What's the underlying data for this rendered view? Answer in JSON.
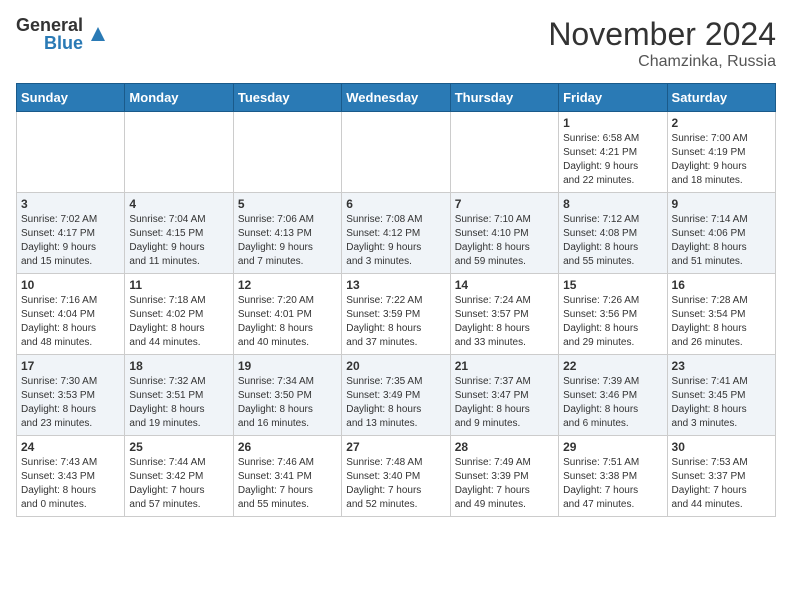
{
  "header": {
    "logo_general": "General",
    "logo_blue": "Blue",
    "month_title": "November 2024",
    "location": "Chamzinka, Russia"
  },
  "days_of_week": [
    "Sunday",
    "Monday",
    "Tuesday",
    "Wednesday",
    "Thursday",
    "Friday",
    "Saturday"
  ],
  "weeks": [
    [
      {
        "day": "",
        "info": ""
      },
      {
        "day": "",
        "info": ""
      },
      {
        "day": "",
        "info": ""
      },
      {
        "day": "",
        "info": ""
      },
      {
        "day": "",
        "info": ""
      },
      {
        "day": "1",
        "info": "Sunrise: 6:58 AM\nSunset: 4:21 PM\nDaylight: 9 hours\nand 22 minutes."
      },
      {
        "day": "2",
        "info": "Sunrise: 7:00 AM\nSunset: 4:19 PM\nDaylight: 9 hours\nand 18 minutes."
      }
    ],
    [
      {
        "day": "3",
        "info": "Sunrise: 7:02 AM\nSunset: 4:17 PM\nDaylight: 9 hours\nand 15 minutes."
      },
      {
        "day": "4",
        "info": "Sunrise: 7:04 AM\nSunset: 4:15 PM\nDaylight: 9 hours\nand 11 minutes."
      },
      {
        "day": "5",
        "info": "Sunrise: 7:06 AM\nSunset: 4:13 PM\nDaylight: 9 hours\nand 7 minutes."
      },
      {
        "day": "6",
        "info": "Sunrise: 7:08 AM\nSunset: 4:12 PM\nDaylight: 9 hours\nand 3 minutes."
      },
      {
        "day": "7",
        "info": "Sunrise: 7:10 AM\nSunset: 4:10 PM\nDaylight: 8 hours\nand 59 minutes."
      },
      {
        "day": "8",
        "info": "Sunrise: 7:12 AM\nSunset: 4:08 PM\nDaylight: 8 hours\nand 55 minutes."
      },
      {
        "day": "9",
        "info": "Sunrise: 7:14 AM\nSunset: 4:06 PM\nDaylight: 8 hours\nand 51 minutes."
      }
    ],
    [
      {
        "day": "10",
        "info": "Sunrise: 7:16 AM\nSunset: 4:04 PM\nDaylight: 8 hours\nand 48 minutes."
      },
      {
        "day": "11",
        "info": "Sunrise: 7:18 AM\nSunset: 4:02 PM\nDaylight: 8 hours\nand 44 minutes."
      },
      {
        "day": "12",
        "info": "Sunrise: 7:20 AM\nSunset: 4:01 PM\nDaylight: 8 hours\nand 40 minutes."
      },
      {
        "day": "13",
        "info": "Sunrise: 7:22 AM\nSunset: 3:59 PM\nDaylight: 8 hours\nand 37 minutes."
      },
      {
        "day": "14",
        "info": "Sunrise: 7:24 AM\nSunset: 3:57 PM\nDaylight: 8 hours\nand 33 minutes."
      },
      {
        "day": "15",
        "info": "Sunrise: 7:26 AM\nSunset: 3:56 PM\nDaylight: 8 hours\nand 29 minutes."
      },
      {
        "day": "16",
        "info": "Sunrise: 7:28 AM\nSunset: 3:54 PM\nDaylight: 8 hours\nand 26 minutes."
      }
    ],
    [
      {
        "day": "17",
        "info": "Sunrise: 7:30 AM\nSunset: 3:53 PM\nDaylight: 8 hours\nand 23 minutes."
      },
      {
        "day": "18",
        "info": "Sunrise: 7:32 AM\nSunset: 3:51 PM\nDaylight: 8 hours\nand 19 minutes."
      },
      {
        "day": "19",
        "info": "Sunrise: 7:34 AM\nSunset: 3:50 PM\nDaylight: 8 hours\nand 16 minutes."
      },
      {
        "day": "20",
        "info": "Sunrise: 7:35 AM\nSunset: 3:49 PM\nDaylight: 8 hours\nand 13 minutes."
      },
      {
        "day": "21",
        "info": "Sunrise: 7:37 AM\nSunset: 3:47 PM\nDaylight: 8 hours\nand 9 minutes."
      },
      {
        "day": "22",
        "info": "Sunrise: 7:39 AM\nSunset: 3:46 PM\nDaylight: 8 hours\nand 6 minutes."
      },
      {
        "day": "23",
        "info": "Sunrise: 7:41 AM\nSunset: 3:45 PM\nDaylight: 8 hours\nand 3 minutes."
      }
    ],
    [
      {
        "day": "24",
        "info": "Sunrise: 7:43 AM\nSunset: 3:43 PM\nDaylight: 8 hours\nand 0 minutes."
      },
      {
        "day": "25",
        "info": "Sunrise: 7:44 AM\nSunset: 3:42 PM\nDaylight: 7 hours\nand 57 minutes."
      },
      {
        "day": "26",
        "info": "Sunrise: 7:46 AM\nSunset: 3:41 PM\nDaylight: 7 hours\nand 55 minutes."
      },
      {
        "day": "27",
        "info": "Sunrise: 7:48 AM\nSunset: 3:40 PM\nDaylight: 7 hours\nand 52 minutes."
      },
      {
        "day": "28",
        "info": "Sunrise: 7:49 AM\nSunset: 3:39 PM\nDaylight: 7 hours\nand 49 minutes."
      },
      {
        "day": "29",
        "info": "Sunrise: 7:51 AM\nSunset: 3:38 PM\nDaylight: 7 hours\nand 47 minutes."
      },
      {
        "day": "30",
        "info": "Sunrise: 7:53 AM\nSunset: 3:37 PM\nDaylight: 7 hours\nand 44 minutes."
      }
    ]
  ]
}
